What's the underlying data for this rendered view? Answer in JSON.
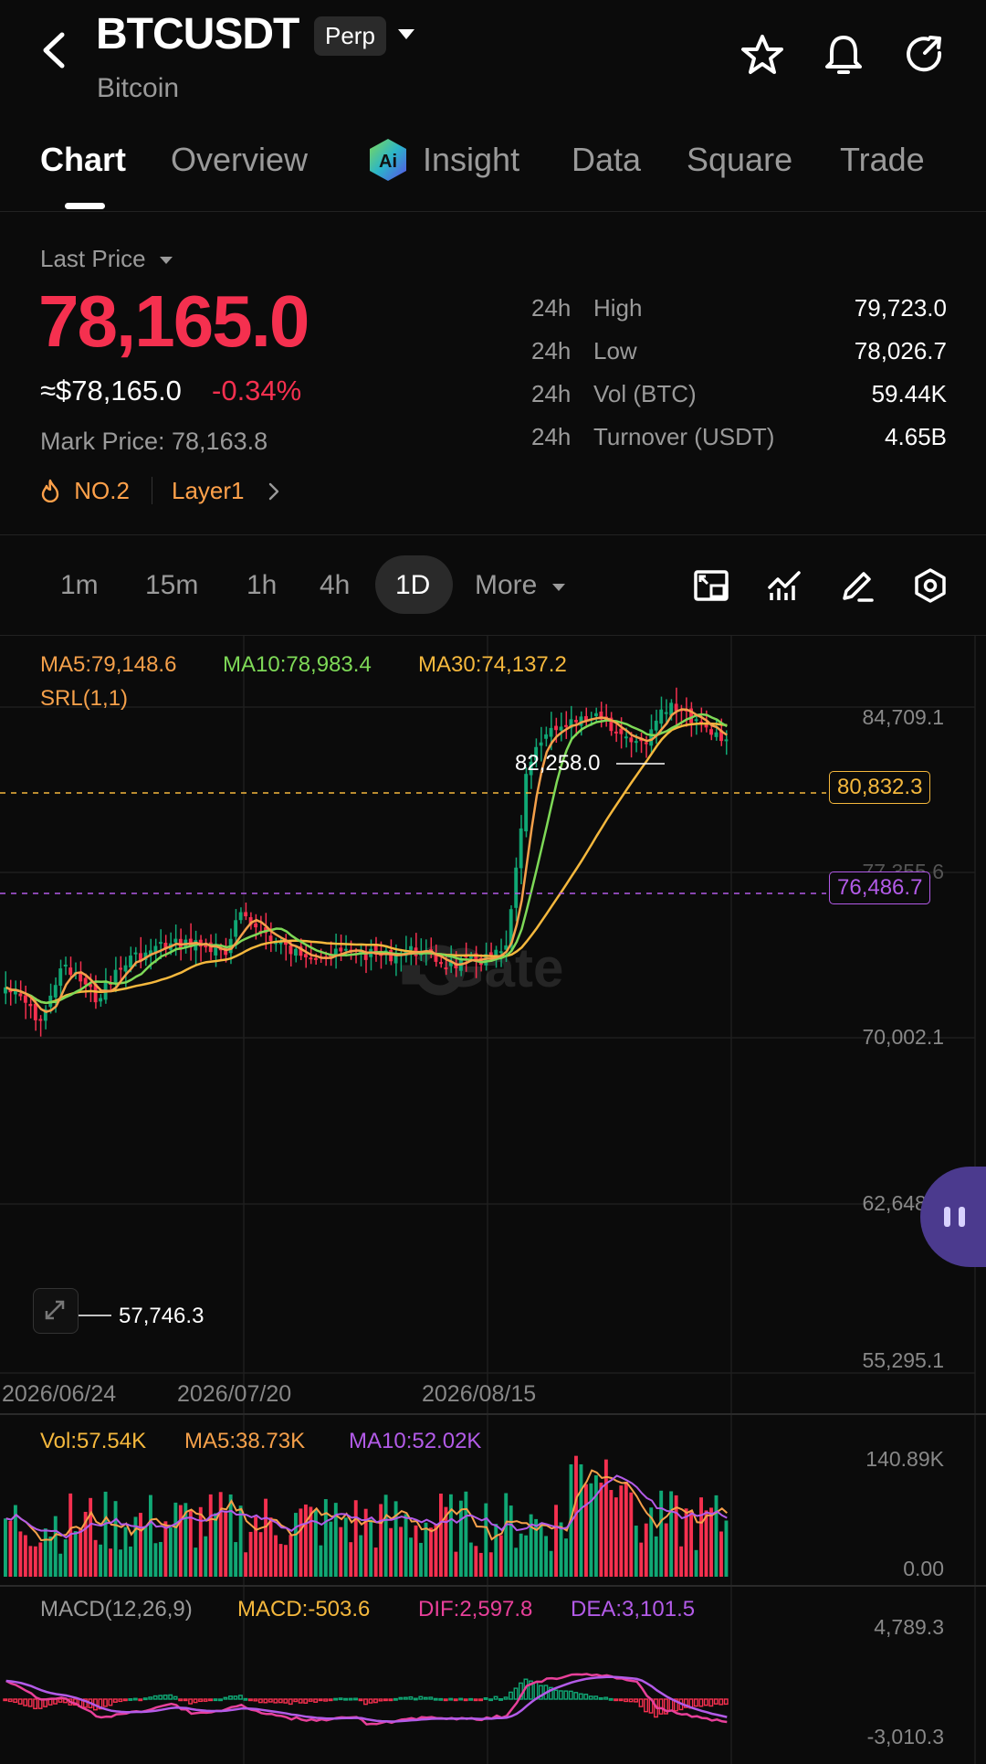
{
  "header": {
    "symbol": "BTCUSDT",
    "contract_type": "Perp",
    "name": "Bitcoin"
  },
  "tabs": [
    {
      "label": "Chart",
      "active": true
    },
    {
      "label": "Overview"
    },
    {
      "label": "Insight"
    },
    {
      "label": "Data"
    },
    {
      "label": "Square"
    },
    {
      "label": "Trade"
    }
  ],
  "price": {
    "last_price_label": "Last Price",
    "last_price": "78,165.0",
    "usd_price": "≈$78,165.0",
    "change_pct": "-0.34%",
    "mark_price": "Mark Price: 78,163.8",
    "rank": "NO.2",
    "sector": "Layer1"
  },
  "stats": [
    {
      "prefix": "24h",
      "label": "High",
      "value": "79,723.0"
    },
    {
      "prefix": "24h",
      "label": "Low",
      "value": "78,026.7"
    },
    {
      "prefix": "24h",
      "label": "Vol (BTC)",
      "value": "59.44K"
    },
    {
      "prefix": "24h",
      "label": "Turnover (USDT)",
      "value": "4.65B"
    }
  ],
  "timeframes": [
    {
      "label": "1m"
    },
    {
      "label": "15m"
    },
    {
      "label": "1h"
    },
    {
      "label": "4h"
    },
    {
      "label": "1D",
      "active": true
    }
  ],
  "more_label": "More",
  "indicators": {
    "ma5": "MA5:79,148.6",
    "ma10": "MA10:78,983.4",
    "ma30": "MA30:74,137.2",
    "srl": "SRL(1,1)",
    "vol": "Vol:57.54K",
    "vol_ma5": "MA5:38.73K",
    "vol_ma10": "MA10:52.02K",
    "macd_name": "MACD(12,26,9)",
    "macd": "MACD:-503.6",
    "dif": "DIF:2,597.8",
    "dea": "DEA:3,101.5"
  },
  "watermark": "Gate",
  "colors": {
    "up": "#10a875",
    "down": "#f5304f",
    "ma5": "#f5a04a",
    "ma10": "#7ed957",
    "ma30": "#f5b83d",
    "purple": "#b35be8",
    "pink": "#e8409a"
  },
  "chart_data": {
    "type": "candlestick",
    "x_ticks": [
      "2026/06/24",
      "2026/07/20",
      "2026/08/15"
    ],
    "y_ticks": [
      "84,709.1",
      "77,355.6",
      "70,002.1",
      "62,648.6",
      "55,295.1"
    ],
    "y_range": [
      55295.1,
      84709.1
    ],
    "highest_label": "82,258.0",
    "lowest_label": "57,746.3",
    "price_lines": [
      {
        "value": "80,832.3",
        "color": "orange"
      },
      {
        "value": "76,486.7",
        "color": "purple"
      }
    ],
    "volume_ticks": [
      "140.89K",
      "0.00"
    ],
    "macd_ticks": [
      "4,789.3",
      "-3,010.3"
    ]
  }
}
